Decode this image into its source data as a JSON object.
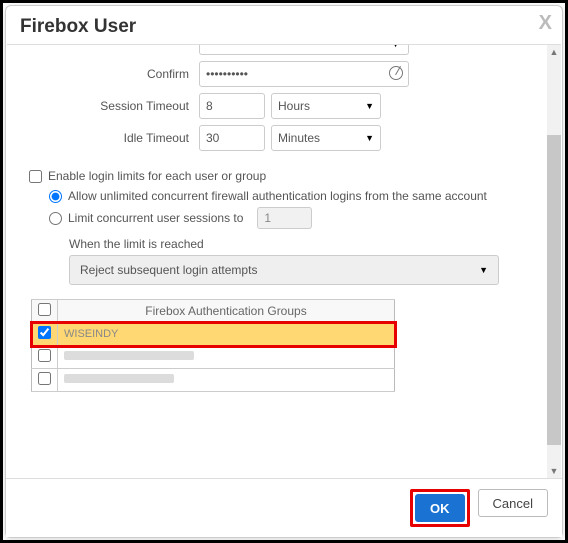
{
  "modal": {
    "title": "Firebox User",
    "close_glyph": "X"
  },
  "form": {
    "confirm_label": "Confirm",
    "confirm_value": "••••••••••",
    "session_label": "Session Timeout",
    "session_value": "8",
    "session_unit": "Hours",
    "idle_label": "Idle Timeout",
    "idle_value": "30",
    "idle_unit": "Minutes"
  },
  "limits": {
    "enable_label": "Enable login limits for each user or group",
    "enable_checked": false,
    "opt_unlimited": "Allow unlimited concurrent firewall authentication logins from the same account",
    "opt_limit": "Limit concurrent user sessions to",
    "limit_value": "1",
    "reach_label": "When the limit is reached",
    "reach_action": "Reject subsequent login attempts",
    "selected_option": "unlimited"
  },
  "groups": {
    "header": "Firebox Authentication Groups",
    "rows": [
      {
        "name": "WISEINDY",
        "checked": true,
        "highlight": true
      },
      {
        "name": "",
        "checked": false,
        "highlight": false
      },
      {
        "name": "",
        "checked": false,
        "highlight": false
      }
    ]
  },
  "footer": {
    "ok": "OK",
    "cancel": "Cancel"
  }
}
